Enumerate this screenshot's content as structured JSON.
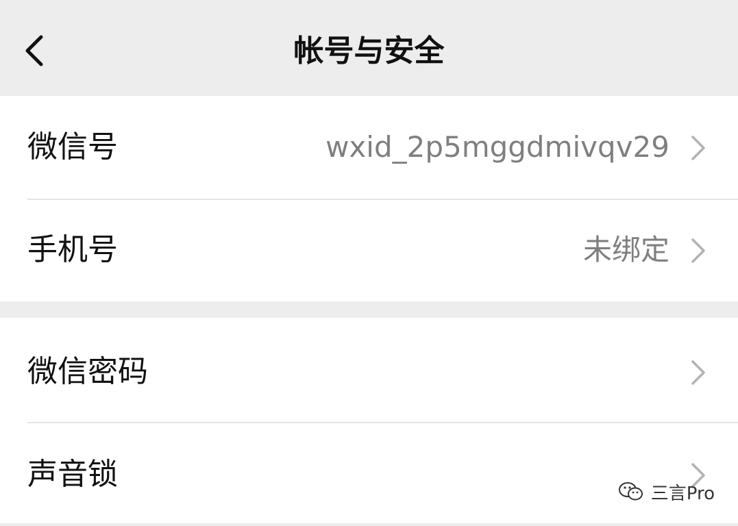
{
  "navbar": {
    "title": "帐号与安全",
    "back_icon": "chevron-left-icon"
  },
  "groups": [
    {
      "items": [
        {
          "label": "微信号",
          "value": "wxid_2p5mggdmivqv29"
        },
        {
          "label": "手机号",
          "value": "未绑定"
        }
      ]
    },
    {
      "items": [
        {
          "label": "微信密码",
          "value": ""
        },
        {
          "label": "声音锁",
          "value": ""
        }
      ]
    }
  ],
  "watermark": {
    "text": "三言Pro",
    "icon": "wechat-icon"
  },
  "colors": {
    "background": "#ededed",
    "cell": "#ffffff",
    "value_text": "#7f7f7f",
    "chevron": "#b2b2b2"
  }
}
